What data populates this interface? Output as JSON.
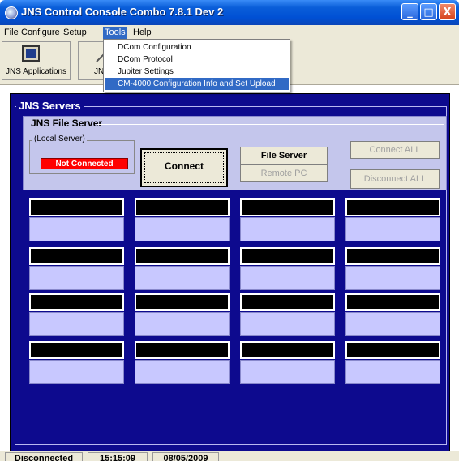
{
  "window": {
    "title": "JNS Control Console   Combo 7.8.1 Dev 2",
    "buttons": {
      "minimize": "_",
      "maximize": "□",
      "close": "X"
    }
  },
  "menubar": {
    "items": [
      "File",
      "Configure",
      "Setup",
      "Tools",
      "Help"
    ],
    "active": "Tools"
  },
  "toolbar": {
    "buttons": [
      {
        "label": "JNS Applications",
        "icon": "monitor-icon"
      },
      {
        "label": "JNS",
        "icon": "pen-icon"
      }
    ]
  },
  "tools_menu": {
    "items": [
      "DCom Configuration",
      "DCom Protocol",
      "Jupiter Settings",
      "CM-4000 Configuration Info and Set Upload"
    ],
    "selected": "CM-4000 Configuration Info and Set Upload"
  },
  "servers": {
    "title": "JNS Servers",
    "file_server": {
      "title": "JNS File Server",
      "local_label": "(Local Server)",
      "status": "Not Connected",
      "connect_label": "Connect",
      "file_server_label": "File Server",
      "remote_pc_label": "Remote PC"
    },
    "connect_all_label": "Connect ALL",
    "disconnect_all_label": "Disconnect ALL"
  },
  "statusbar": {
    "connection": "Disconnected",
    "time": "15:15:09",
    "date": "08/05/2009"
  },
  "colors": {
    "panel_bg": "#0d0a8e",
    "file_server_bg": "#c4c6ec",
    "slot_top": "#000000",
    "slot_bottom": "#c8c8ff",
    "status_red": "#ff0000",
    "menu_highlight": "#316ac5"
  }
}
